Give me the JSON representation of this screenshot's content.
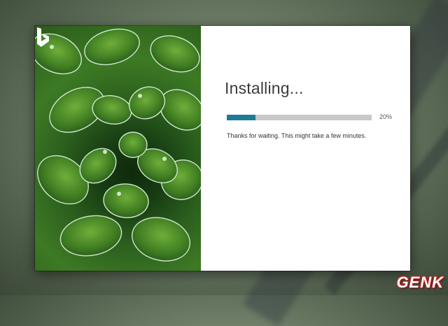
{
  "installer": {
    "title": "Installing...",
    "progress_fraction": 0.2,
    "progress_label": "20%",
    "message": "Thanks for waiting. This might take a few minutes."
  },
  "hero": {
    "logo": "bing-logo-icon"
  },
  "watermark": {
    "text": "GENK"
  },
  "colors": {
    "accent": "#1d7b97",
    "track": "#c8c8c8",
    "watermark": "#c61d1d"
  }
}
